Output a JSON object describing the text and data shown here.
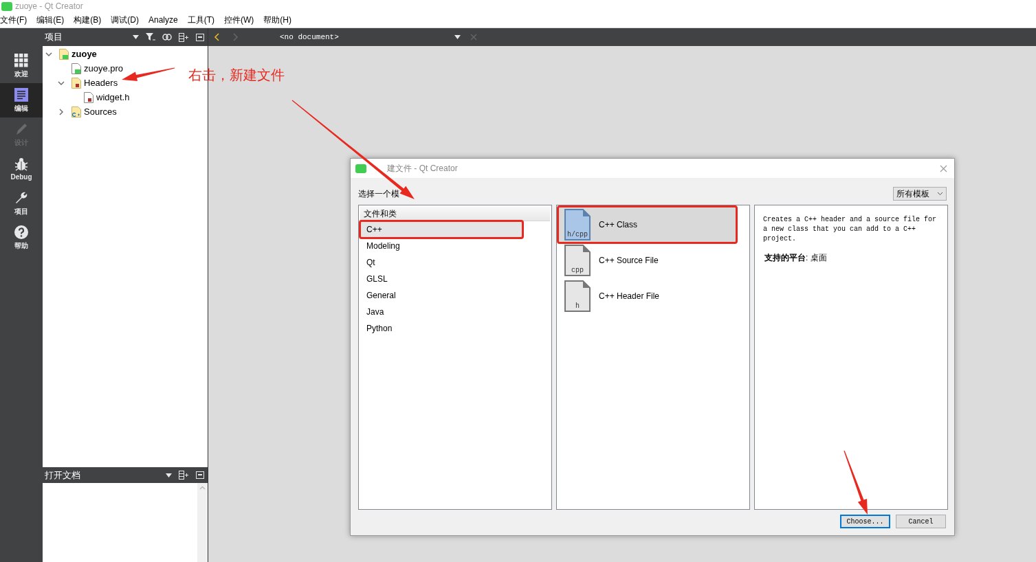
{
  "window": {
    "title": "zuoye - Qt Creator"
  },
  "menu": [
    "文件(F)",
    "编辑(E)",
    "构建(B)",
    "调试(D)",
    "Analyze",
    "工具(T)",
    "控件(W)",
    "帮助(H)"
  ],
  "mode_bar": [
    {
      "label": "欢迎",
      "kind": "welcome",
      "selected": false,
      "disabled": false
    },
    {
      "label": "编辑",
      "kind": "edit",
      "selected": true,
      "disabled": false
    },
    {
      "label": "设计",
      "kind": "design",
      "selected": false,
      "disabled": true
    },
    {
      "label": "Debug",
      "kind": "debug",
      "selected": false,
      "disabled": false
    },
    {
      "label": "项目",
      "kind": "projects",
      "selected": false,
      "disabled": false
    },
    {
      "label": "帮助",
      "kind": "help",
      "selected": false,
      "disabled": false
    }
  ],
  "project_panel": {
    "title": "项目",
    "tree": [
      {
        "label": "zuoye",
        "kind": "project",
        "expanded": true,
        "children": [
          {
            "label": "zuoye.pro",
            "kind": "pro_file"
          },
          {
            "label": "Headers",
            "kind": "header_folder",
            "expanded": true,
            "children": [
              {
                "label": "widget.h",
                "kind": "header_file"
              }
            ]
          },
          {
            "label": "Sources",
            "kind": "source_folder",
            "expanded": false
          }
        ]
      }
    ]
  },
  "editor_toolbar": {
    "document": "<no document>"
  },
  "open_documents": {
    "title": "打开文档"
  },
  "annotation": {
    "text": "右击，新建文件"
  },
  "dialog": {
    "title": "建文件 - Qt Creator",
    "prompt": "选择一个模",
    "filter": "所有模板",
    "categories_header": "文件和类",
    "categories": [
      {
        "label": "C++",
        "selected": true,
        "highlighted": true
      },
      {
        "label": "Modeling",
        "selected": false,
        "highlighted": false
      },
      {
        "label": "Qt",
        "selected": false,
        "highlighted": false
      },
      {
        "label": "GLSL",
        "selected": false,
        "highlighted": false
      },
      {
        "label": "General",
        "selected": false,
        "highlighted": false
      },
      {
        "label": "Java",
        "selected": false,
        "highlighted": false
      },
      {
        "label": "Python",
        "selected": false,
        "highlighted": false
      }
    ],
    "templates": [
      {
        "label": "C++ Class",
        "icon_label": "h/cpp",
        "selected": true,
        "highlighted": true
      },
      {
        "label": "C++ Source File",
        "icon_label": "cpp",
        "selected": false,
        "highlighted": false
      },
      {
        "label": "C++ Header File",
        "icon_label": "h",
        "selected": false,
        "highlighted": false
      }
    ],
    "description": "Creates a C++ header and a source file for a new class that you can add to a C++ project.",
    "platforms": "**支持的平台**: 桌面",
    "buttons": [
      {
        "label": "Choose...",
        "kind": "default"
      },
      {
        "label": "Cancel",
        "kind": "normal"
      }
    ]
  }
}
